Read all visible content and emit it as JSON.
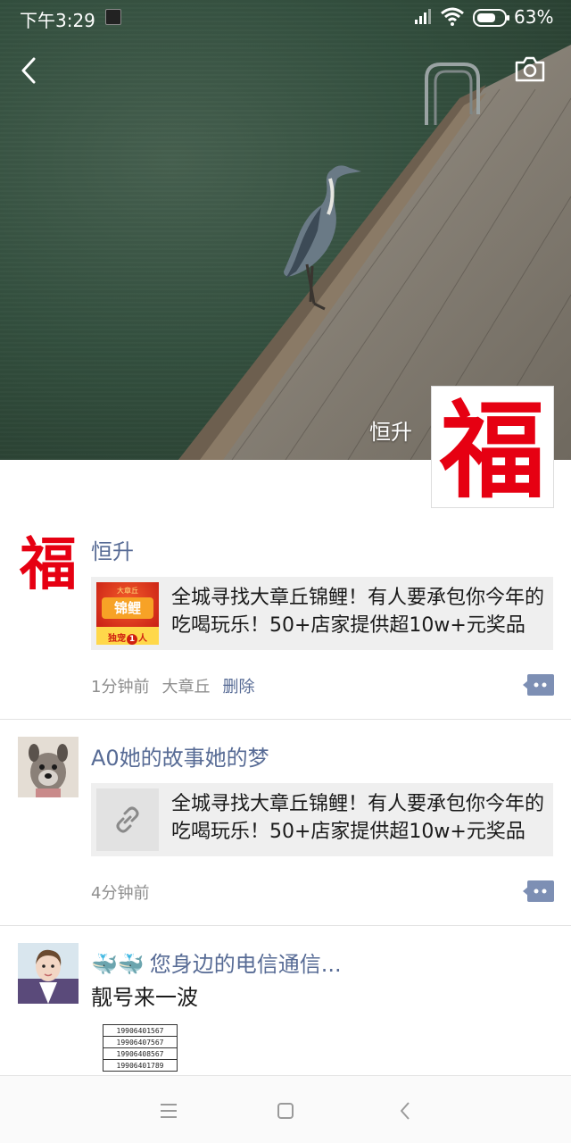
{
  "status_bar": {
    "time": "下午3:29",
    "battery_percent": "63%",
    "app_indicator_icon": "soul-app-icon",
    "signal_icon": "cellular-signal-icon",
    "wifi_icon": "wifi-icon",
    "battery_icon": "battery-icon"
  },
  "header": {
    "back_icon": "chevron-left-icon",
    "camera_icon": "camera-icon",
    "profile_name": "恒升",
    "profile_avatar_glyph": "福"
  },
  "posts": [
    {
      "author": "恒升",
      "avatar_glyph": "福",
      "card_text": "全城寻找大章丘锦鲤！有人要承包你今年的吃喝玩乐！50+店家提供超10w+元奖品",
      "card_thumb": {
        "top": "大章丘",
        "main": "锦鲤",
        "bottom": "独宠",
        "bottom_num": "1",
        "bottom_tail": "人"
      },
      "time": "1分钟前",
      "location": "大章丘",
      "delete_label": "删除"
    },
    {
      "author": "A0她的故事她的梦",
      "card_text": "全城寻找大章丘锦鲤！有人要承包你今年的吃喝玩乐！50+店家提供超10w+元奖品",
      "card_icon": "link-icon",
      "time": "4分钟前"
    },
    {
      "author_emoji": "🐳🐳",
      "author": "您身边的电信通信...",
      "body": "靓号来一波",
      "numbers": [
        "19906401567",
        "19906407567",
        "19906408567",
        "19906401789"
      ]
    }
  ],
  "colors": {
    "link_blue": "#576b95",
    "card_bg": "#efefef",
    "fu_red": "#e60012"
  },
  "nav_bar": {
    "menu_icon": "menu-icon",
    "home_icon": "home-square-icon",
    "back_icon": "back-triangle-icon"
  }
}
